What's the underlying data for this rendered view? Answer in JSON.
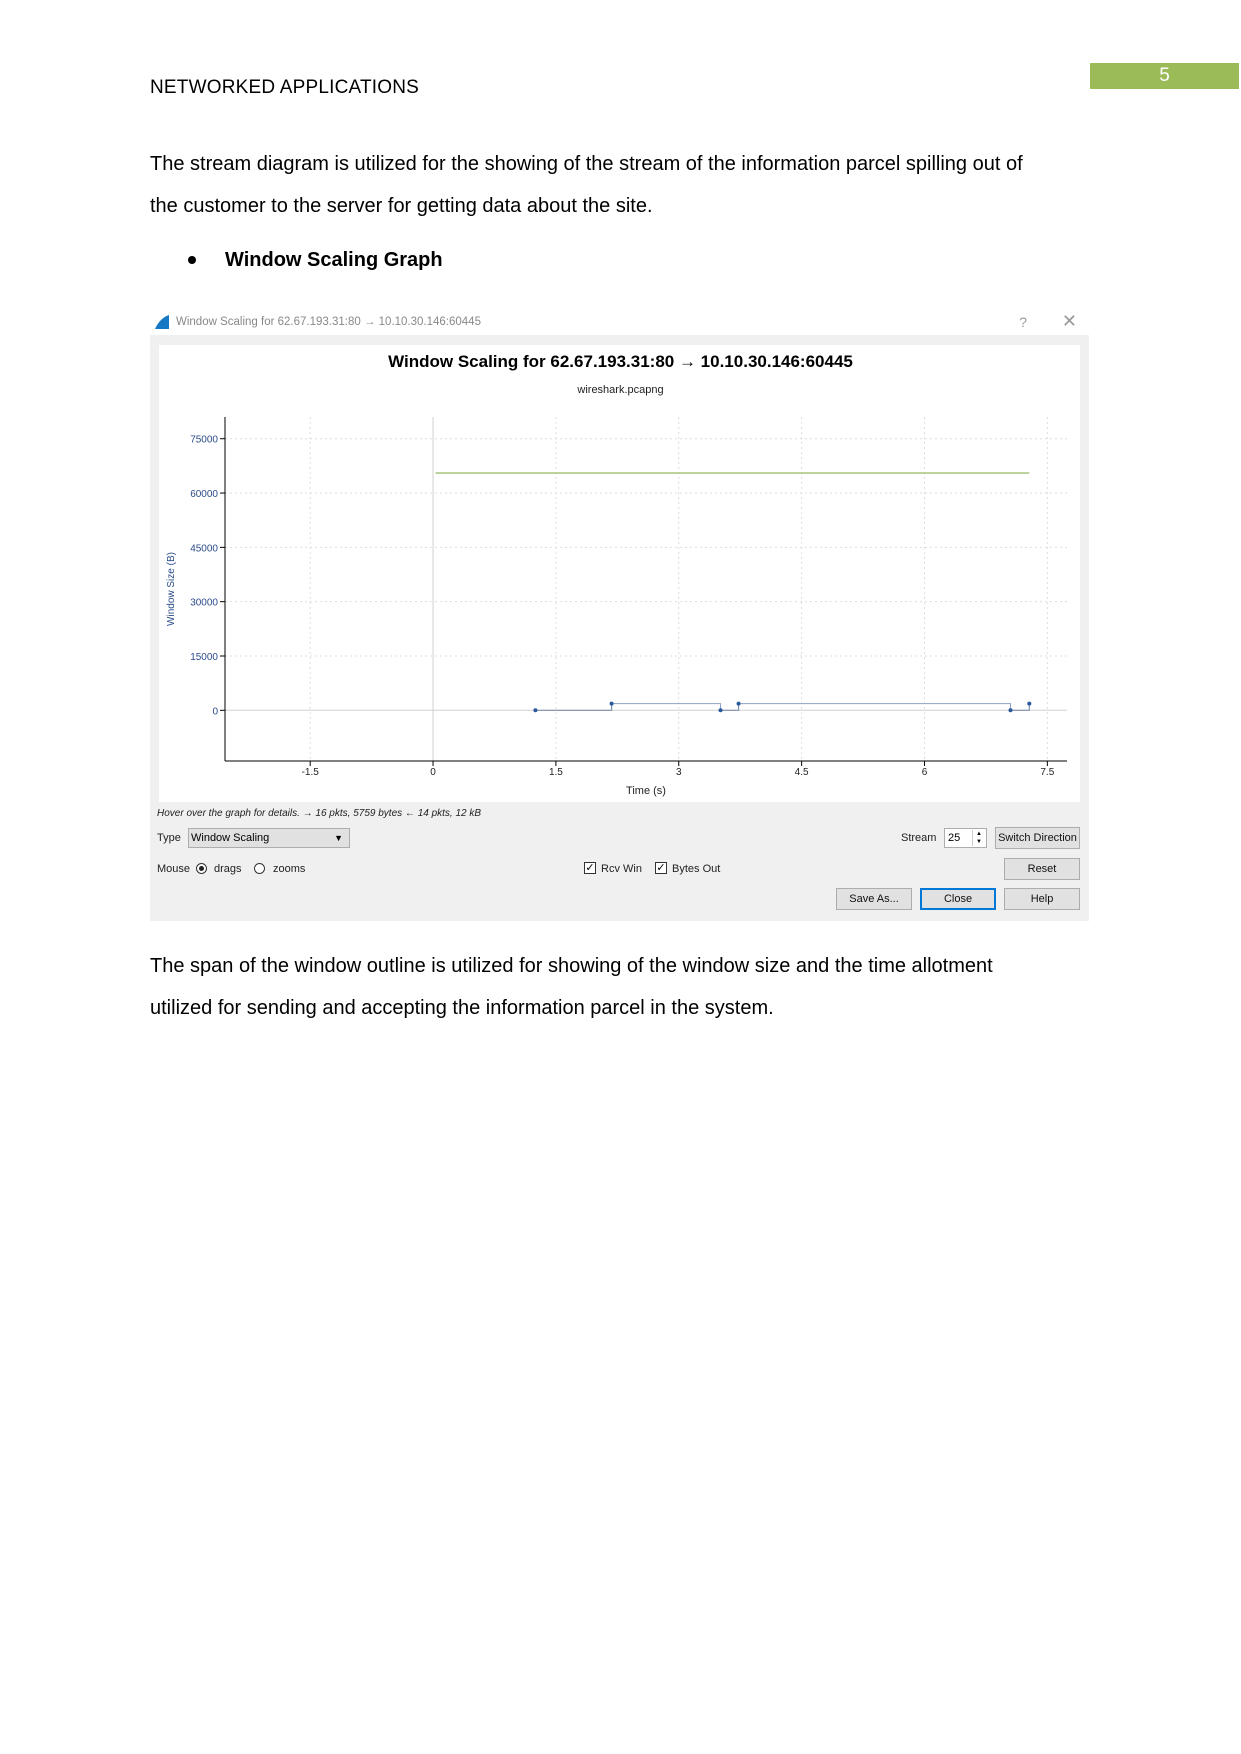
{
  "page": {
    "header": "NETWORKED APPLICATIONS",
    "page_number": "5",
    "paragraph1": [
      "The stream diagram is utilized for the showing of the stream of the information parcel spilling out of",
      "the customer to the server for getting data about the site."
    ],
    "bullet": "Window Scaling Graph",
    "paragraph2": [
      "The span of the window outline is utilized for showing of the window size and the time allotment",
      "utilized for sending and accepting the information parcel in the system."
    ],
    "accent_color": "#9bbb59"
  },
  "dialog": {
    "window_title": "Window Scaling for 62.67.193.31:80 → 10.10.30.146:60445",
    "help_glyph": "?",
    "close_glyph": "✕",
    "hint": "Hover over the graph for details. → 16 pkts, 5759 bytes ← 14 pkts, 12 kB",
    "type_label": "Type",
    "type_value": "Window Scaling",
    "stream_label": "Stream",
    "stream_value": "25",
    "switch_direction": "Switch Direction",
    "mouse_label": "Mouse",
    "radio_drags": "drags",
    "radio_zooms": "zooms",
    "mouse_mode": "drags",
    "check_rcv_win": "Rcv Win",
    "check_bytes_out": "Bytes Out",
    "rcv_win_checked": true,
    "bytes_out_checked": true,
    "reset": "Reset",
    "save_as": "Save As...",
    "close": "Close",
    "help": "Help"
  },
  "chart_data": {
    "type": "line",
    "title": "Window Scaling for 62.67.193.31:80 → 10.10.30.146:60445",
    "subtitle": "wireshark.pcapng",
    "xlabel": "Time (s)",
    "ylabel": "Window Size (B)",
    "xlim": [
      -2.54,
      7.74
    ],
    "ylim": [
      -14000,
      81000
    ],
    "xticks": [
      "-1.5",
      "0",
      "1.5",
      "3",
      "4.5",
      "6",
      "7.5"
    ],
    "yticks": [
      "0",
      "15000",
      "30000",
      "45000",
      "60000",
      "75000"
    ],
    "grid": true,
    "series": [
      {
        "name": "Rcv Win",
        "color": "#a9c47f",
        "style": "line",
        "points": [
          [
            0.03,
            65535
          ],
          [
            7.28,
            65535
          ]
        ]
      },
      {
        "name": "Bytes Out",
        "color": "#2a5a9a",
        "style": "step-markers",
        "points": [
          [
            1.25,
            0
          ],
          [
            2.18,
            1860
          ],
          [
            3.51,
            0
          ],
          [
            3.73,
            1860
          ],
          [
            7.05,
            0
          ],
          [
            7.28,
            1860
          ]
        ]
      }
    ]
  }
}
